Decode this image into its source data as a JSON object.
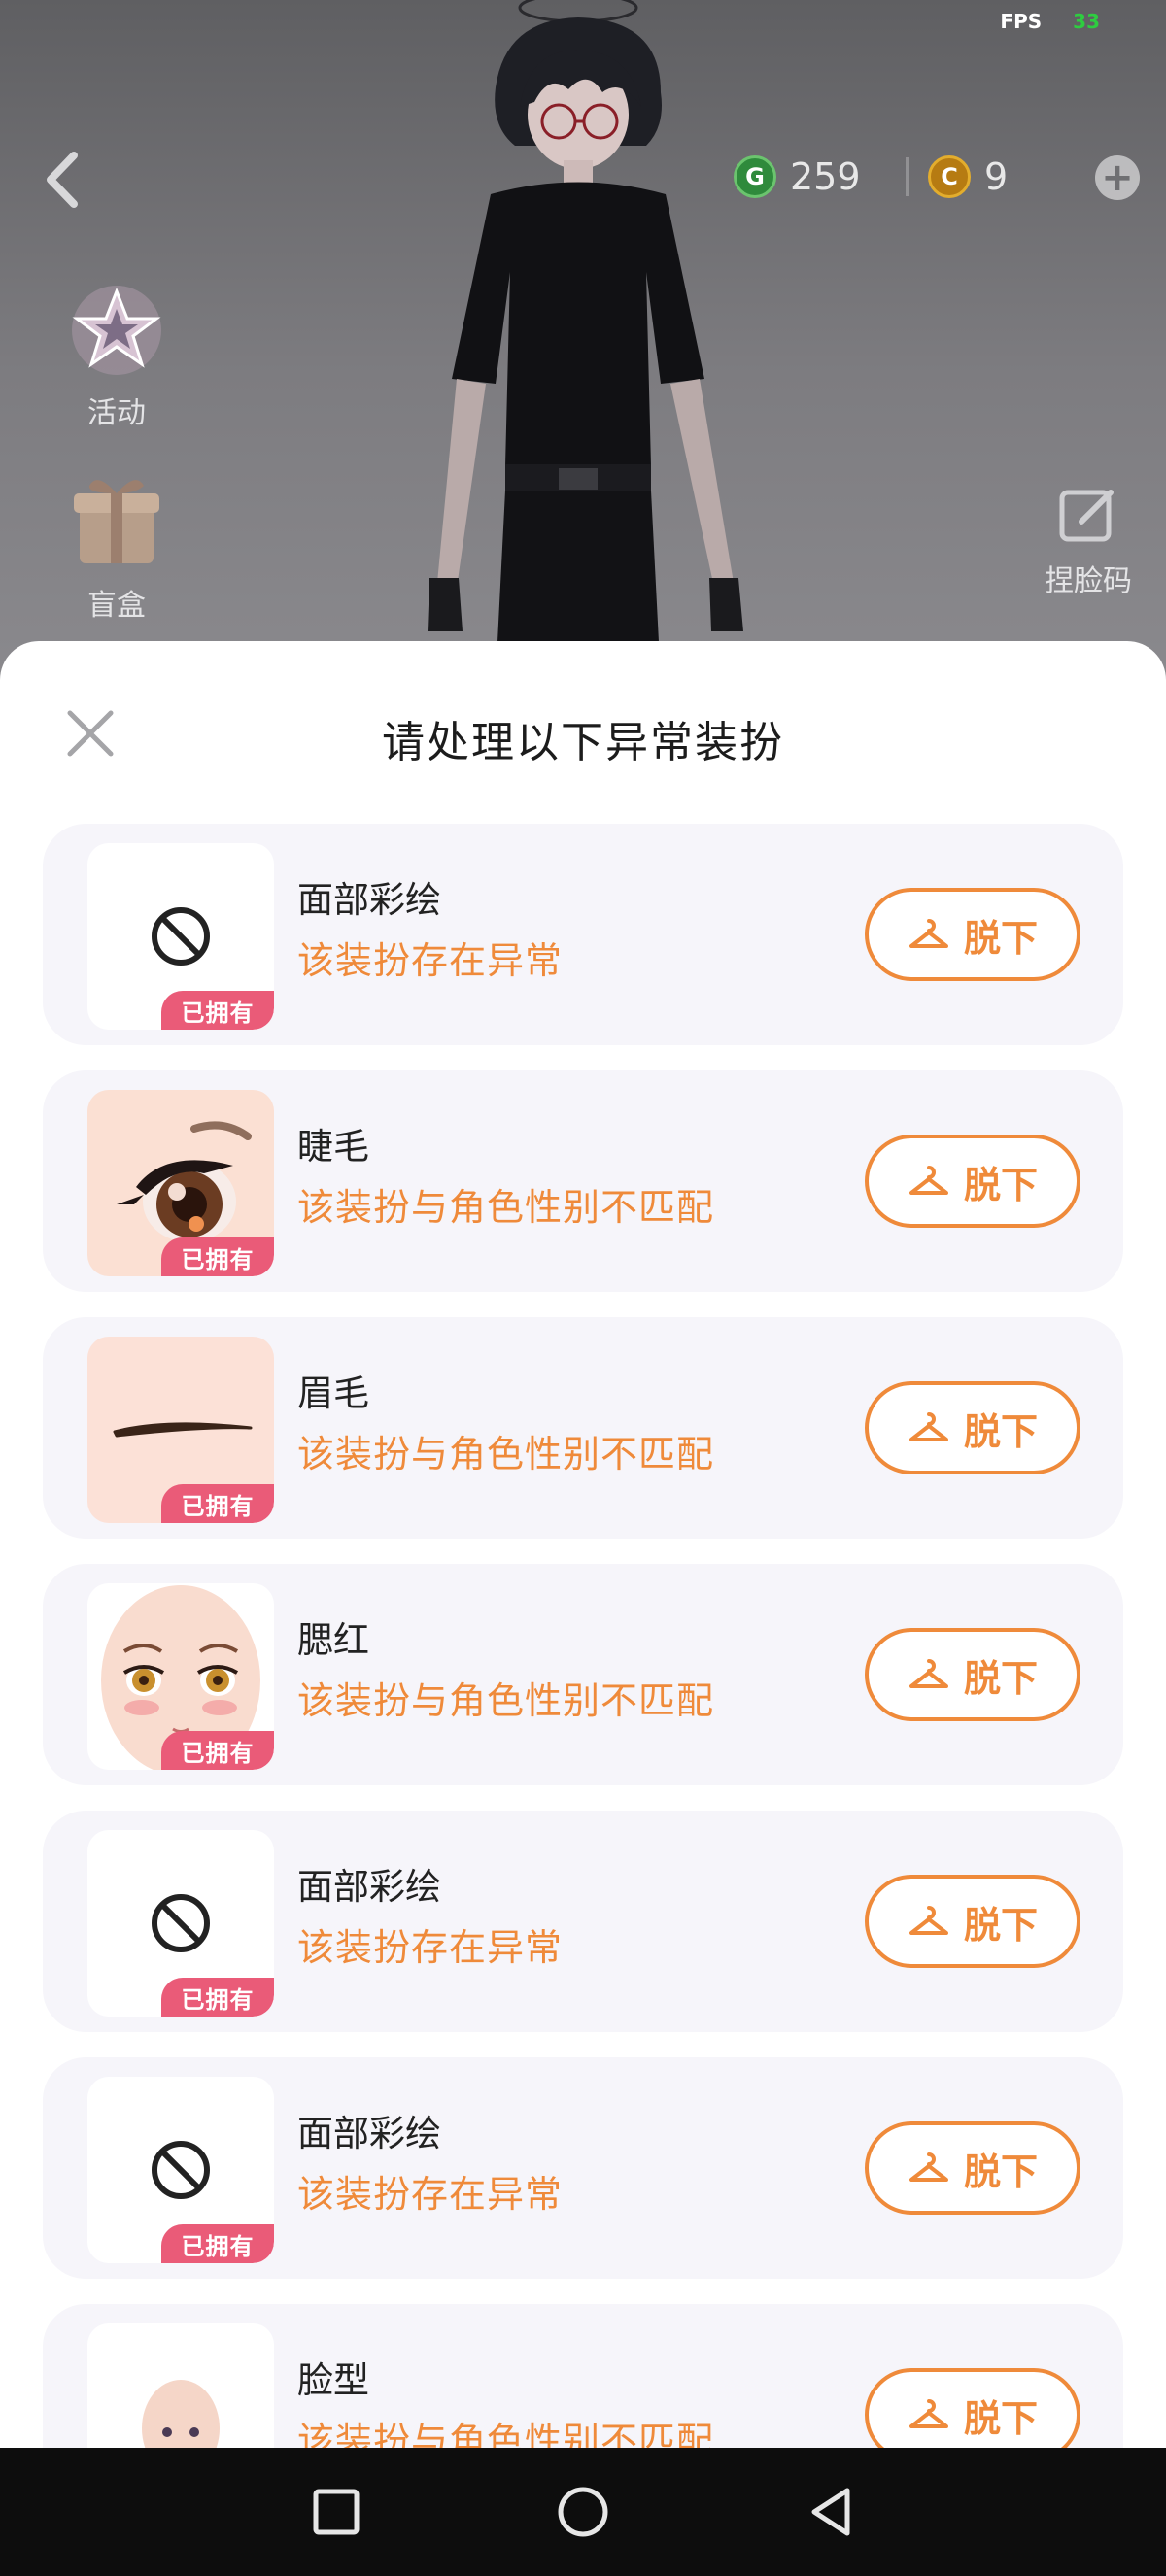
{
  "status": {
    "fps_label": "FPS",
    "fps_value": "33"
  },
  "currencies": [
    {
      "name": "green-coin",
      "glyph": "G",
      "amount": "259",
      "color": "#2f8a3c"
    },
    {
      "name": "gold-coin",
      "glyph": "C",
      "amount": "9",
      "color": "#b67b12"
    }
  ],
  "side_buttons": {
    "activity": "活动",
    "blind_box": "盲盒",
    "face_code": "捏脸码"
  },
  "modal": {
    "title": "请处理以下异常装扮",
    "owned_badge": "已拥有",
    "unequip_label": "脱下",
    "items": [
      {
        "name": "面部彩绘",
        "reason": "该装扮存在异常",
        "thumb": "forbidden-icon"
      },
      {
        "name": "睫毛",
        "reason": "该装扮与角色性别不匹配",
        "thumb": "eyelash-thumbnail"
      },
      {
        "name": "眉毛",
        "reason": "该装扮与角色性别不匹配",
        "thumb": "eyebrow-thumbnail"
      },
      {
        "name": "腮红",
        "reason": "该装扮与角色性别不匹配",
        "thumb": "blush-face-thumbnail"
      },
      {
        "name": "面部彩绘",
        "reason": "该装扮存在异常",
        "thumb": "forbidden-icon"
      },
      {
        "name": "面部彩绘",
        "reason": "该装扮存在异常",
        "thumb": "forbidden-icon"
      },
      {
        "name": "脸型",
        "reason": "该装扮与角色性别不匹配",
        "thumb": "face-shape-thumbnail"
      }
    ]
  },
  "colors": {
    "accent_orange": "#ef8a3a",
    "owned_pink": "#ea5b78",
    "card_bg": "#f6f5fa"
  }
}
